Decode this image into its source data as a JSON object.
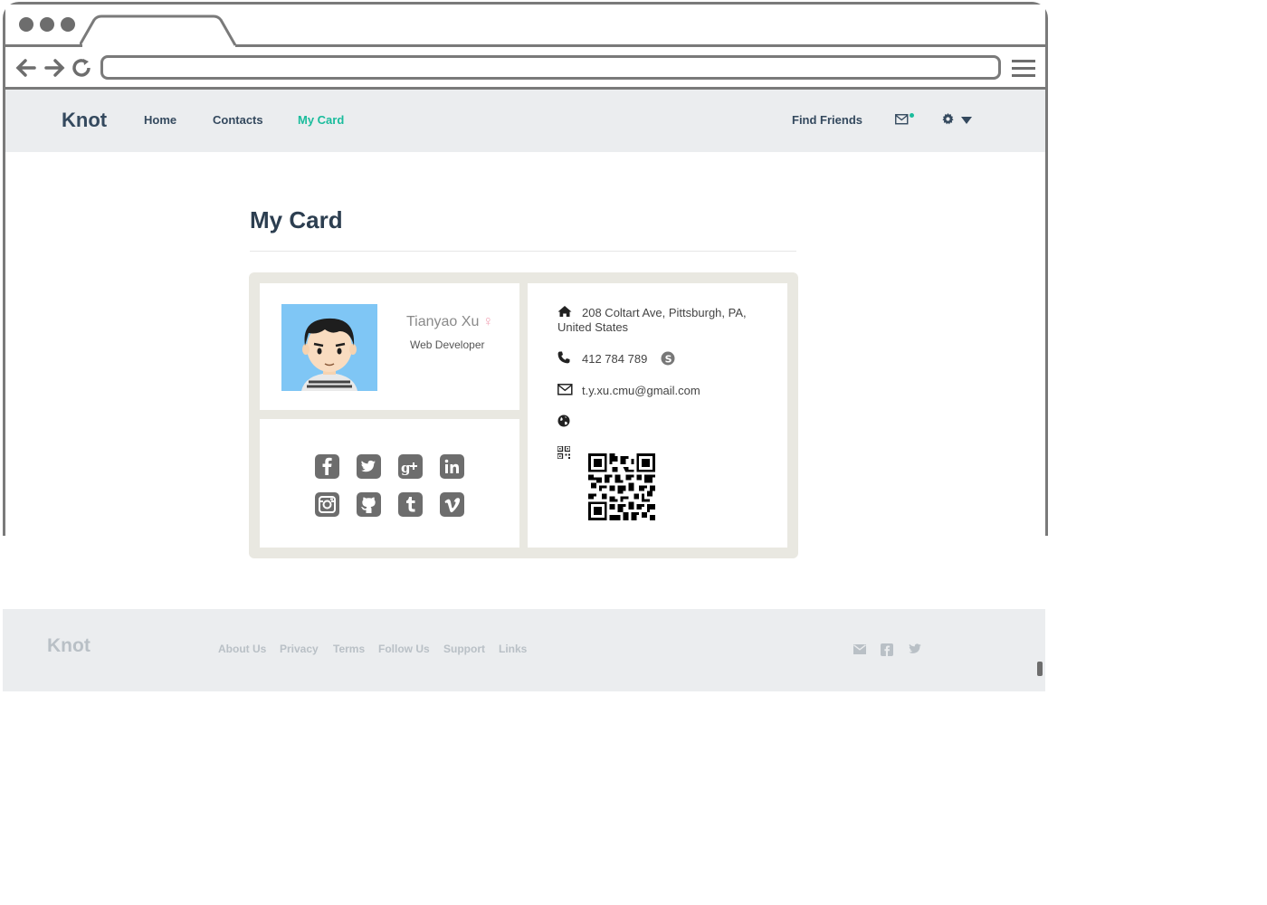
{
  "nav": {
    "brand": "Knot",
    "links": [
      "Home",
      "Contacts",
      "My Card"
    ],
    "active": "My Card",
    "find_friends": "Find Friends",
    "icons": [
      "mail-icon",
      "gear-icon",
      "caret-down-icon"
    ],
    "accent_color": "#1abc9c"
  },
  "page": {
    "title": "My Card"
  },
  "profile": {
    "name": "Tianyao Xu",
    "gender_symbol": "♀",
    "job_title": "Web Developer"
  },
  "social": {
    "icons": [
      "facebook-icon",
      "twitter-icon",
      "google-plus-icon",
      "linkedin-icon",
      "instagram-icon",
      "github-icon",
      "tumblr-icon",
      "vimeo-icon"
    ]
  },
  "contact": {
    "address_line1": "208 Coltart Ave, Pittsburgh, PA,",
    "address_line2": "United States",
    "phone": "412 784 789",
    "email": "t.y.xu.cmu@gmail.com"
  },
  "footer": {
    "brand": "Knot",
    "links": [
      "About Us",
      "Privacy",
      "Terms",
      "Follow Us",
      "Support",
      "Links"
    ],
    "icons": [
      "mail-icon",
      "facebook-icon",
      "twitter-icon"
    ]
  },
  "colors": {
    "nav_bg": "#ebedef",
    "text_dark": "#34495e",
    "card_bg": "#e9e8e1",
    "footer_text": "#b9c0c6"
  }
}
